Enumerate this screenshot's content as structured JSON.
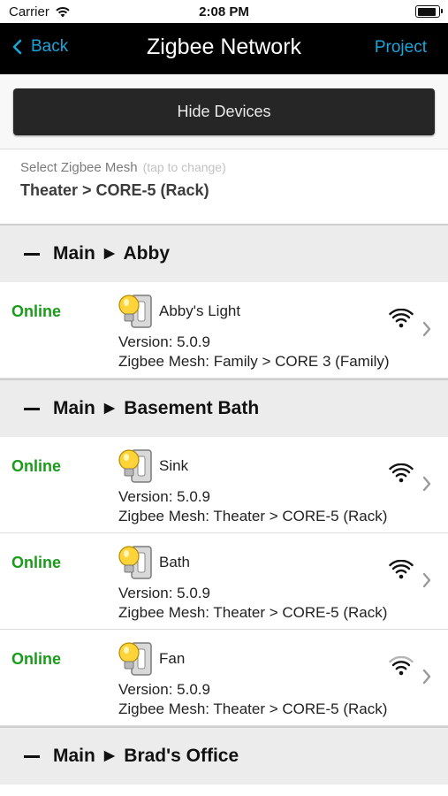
{
  "status_bar": {
    "carrier": "Carrier",
    "time": "2:08 PM"
  },
  "nav": {
    "back_label": "Back",
    "title": "Zigbee Network",
    "right_label": "Project"
  },
  "hide_button_label": "Hide Devices",
  "mesh_selector": {
    "label": "Select Zigbee Mesh",
    "hint": "(tap to change)",
    "value": "Theater > CORE-5 (Rack)"
  },
  "groups": [
    {
      "title": "Main ► Abby",
      "devices": [
        {
          "status": "Online",
          "name": "Abby's Light",
          "version": "Version: 5.0.9",
          "mesh": "Zigbee Mesh: Family > CORE 3 (Family)"
        }
      ]
    },
    {
      "title": "Main ► Basement Bath",
      "devices": [
        {
          "status": "Online",
          "name": "Sink",
          "version": "Version: 5.0.9",
          "mesh": "Zigbee Mesh: Theater > CORE-5 (Rack)"
        },
        {
          "status": "Online",
          "name": "Bath",
          "version": "Version: 5.0.9",
          "mesh": "Zigbee Mesh: Theater > CORE-5 (Rack)"
        },
        {
          "status": "Online",
          "name": "Fan",
          "version": "Version: 5.0.9",
          "mesh": "Zigbee Mesh: Theater > CORE-5 (Rack)"
        }
      ]
    },
    {
      "title": "Main ► Brad's Office",
      "devices": []
    }
  ],
  "colors": {
    "accent": "#1aa5d8",
    "online": "#1a9b1a",
    "nav_background": "#000000",
    "button_background": "#262626"
  },
  "icons": [
    "wifi-icon",
    "battery-icon",
    "back-chevron-icon",
    "minus-icon",
    "bulb-switch-icon",
    "signal-strength-icon",
    "disclosure-chevron-icon"
  ]
}
